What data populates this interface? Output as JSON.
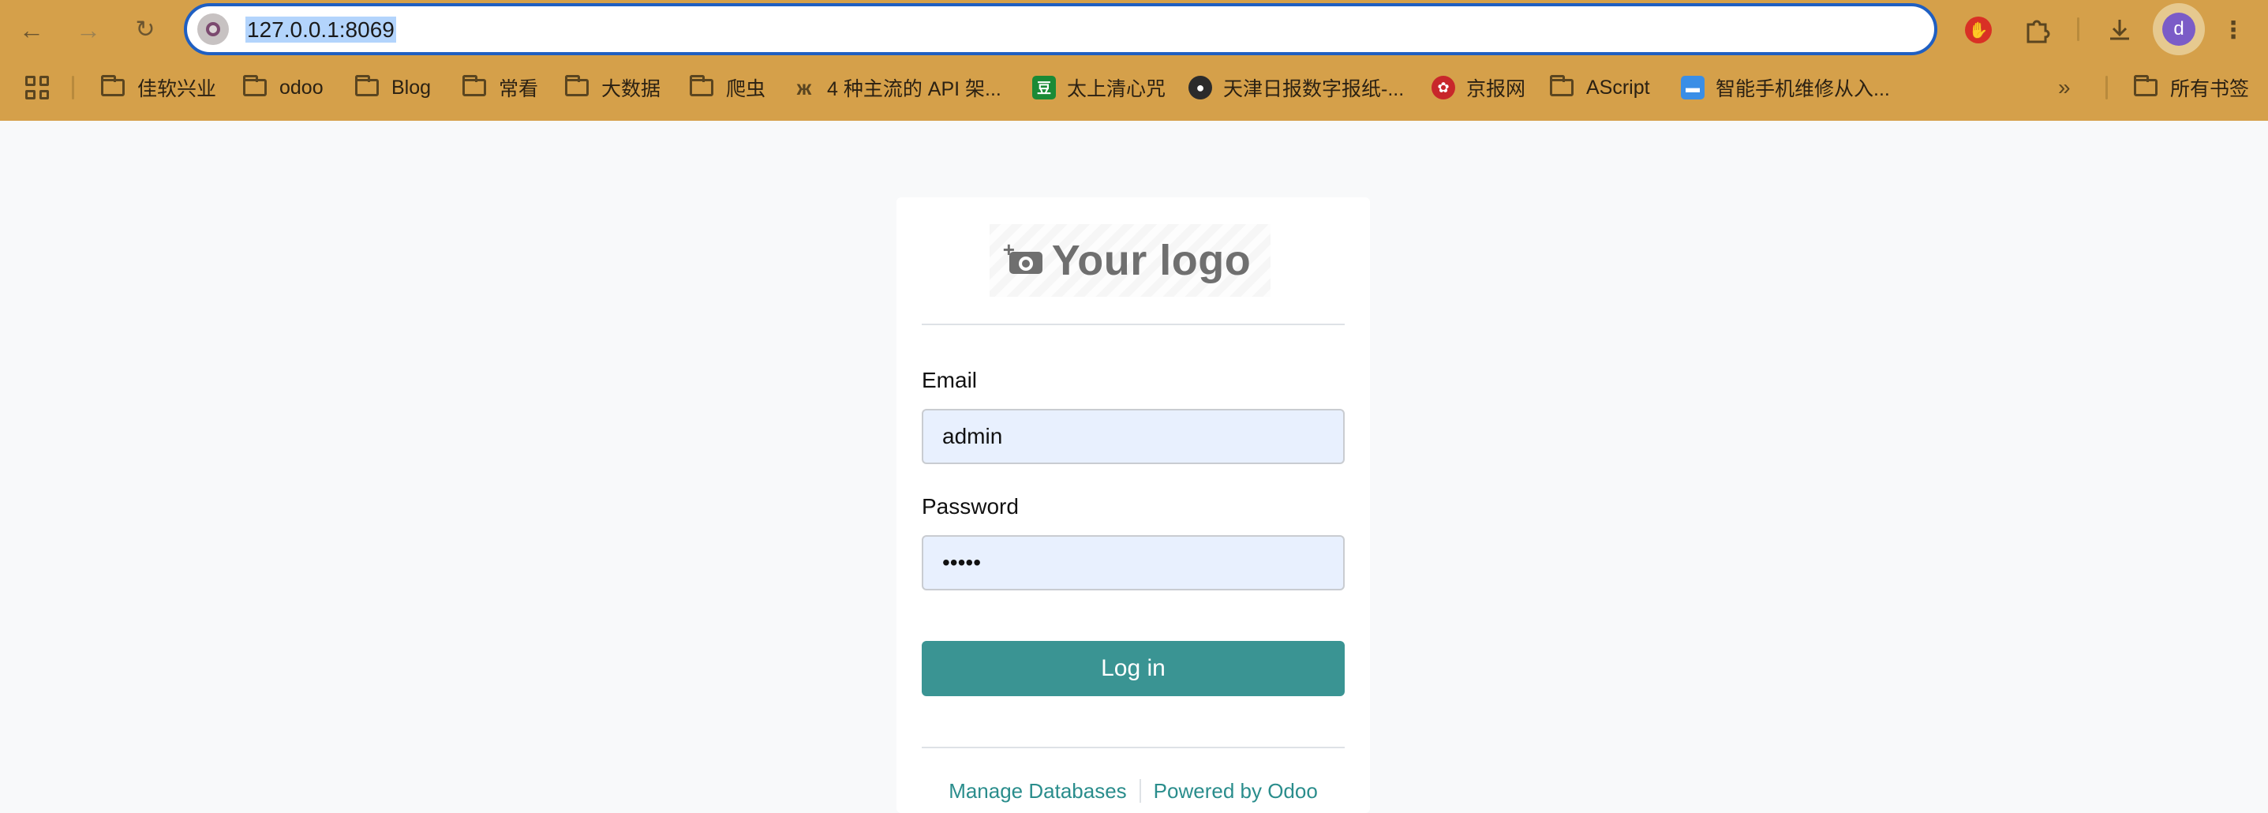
{
  "browser": {
    "url": "127.0.0.1:8069",
    "avatar_letter": "d",
    "bookmarks": [
      {
        "label": "佳软兴业",
        "icon": "folder-icon"
      },
      {
        "label": "odoo",
        "icon": "folder-icon"
      },
      {
        "label": "Blog",
        "icon": "folder-icon"
      },
      {
        "label": "常看",
        "icon": "folder-icon"
      },
      {
        "label": "大数据",
        "icon": "folder-icon"
      },
      {
        "label": "爬虫",
        "icon": "folder-icon"
      },
      {
        "label": "4 种主流的 API 架...",
        "icon": "site-favicon"
      },
      {
        "label": "太上清心咒",
        "icon": "douban-favicon"
      },
      {
        "label": "天津日报数字报纸-...",
        "icon": "globe-icon"
      },
      {
        "label": "京报网",
        "icon": "site-favicon"
      },
      {
        "label": "AScript",
        "icon": "folder-icon"
      },
      {
        "label": "智能手机维修从入...",
        "icon": "site-favicon"
      }
    ],
    "all_bookmarks_label": "所有书签"
  },
  "login": {
    "logo_text": "Your logo",
    "email_label": "Email",
    "email_value": "admin",
    "password_label": "Password",
    "password_value": "•••••",
    "login_button": "Log in",
    "manage_databases": "Manage Databases",
    "powered_by": "Powered by Odoo"
  },
  "colors": {
    "toolbar": "#d5a04a",
    "accent": "#3a9493",
    "link": "#2a8d8c",
    "input_bg": "#e8f0fe"
  }
}
